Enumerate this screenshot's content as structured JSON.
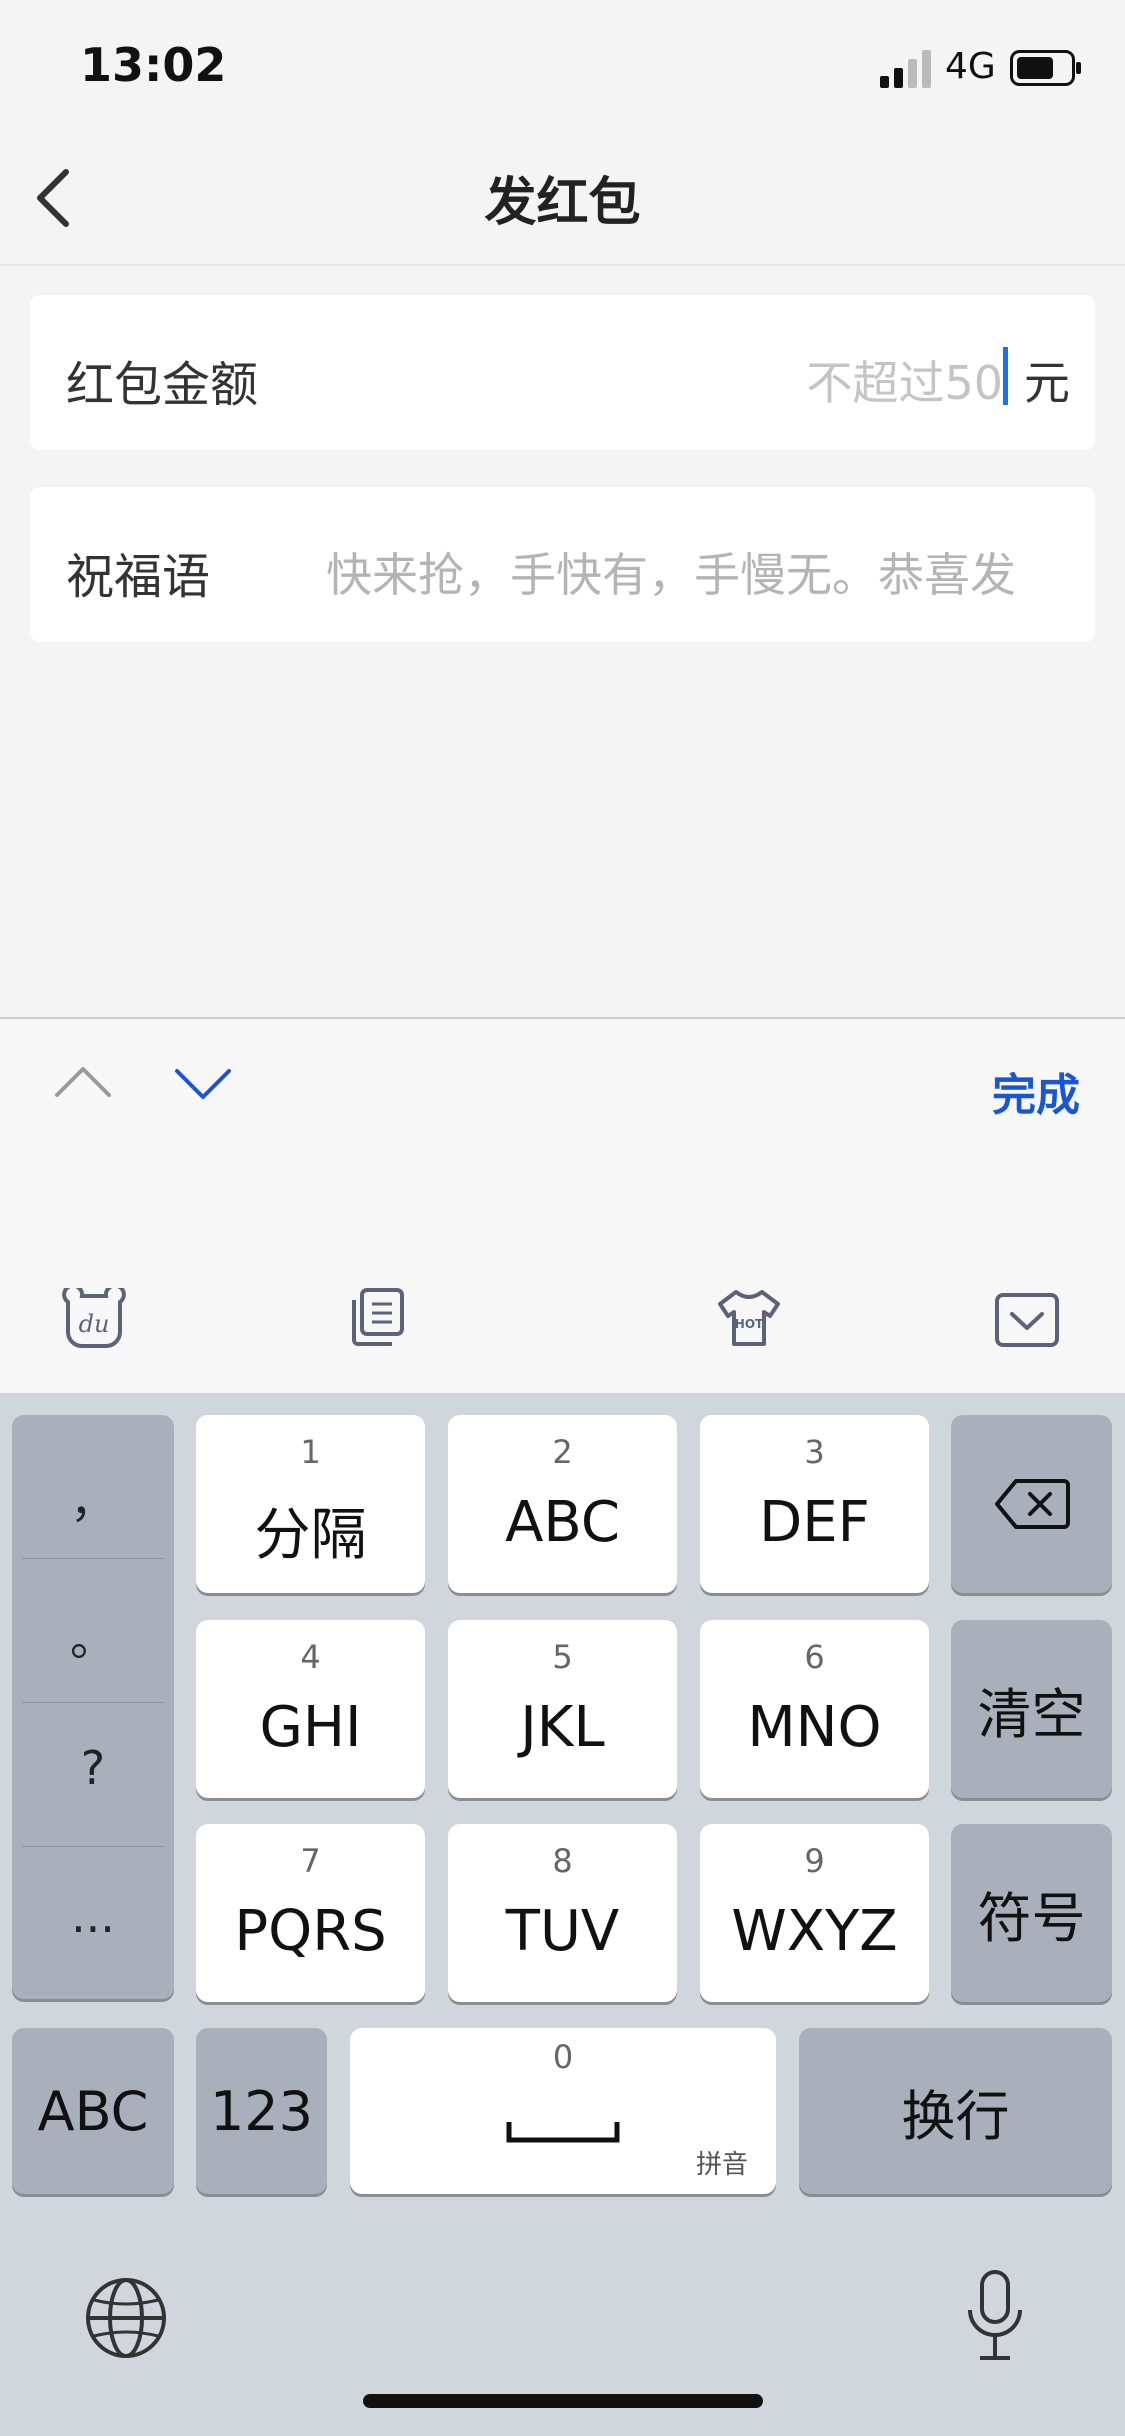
{
  "status_bar": {
    "time": "13:02",
    "network": "4G"
  },
  "nav": {
    "title": "发红包"
  },
  "amount": {
    "label": "红包金额",
    "placeholder": "不超过50",
    "unit": "元"
  },
  "greeting": {
    "label": "祝福语",
    "placeholder": "快来抢，手快有，手慢无。恭喜发"
  },
  "accessory": {
    "done_label": "完成"
  },
  "ime_toolbar": {
    "icons": [
      "du-logo-icon",
      "clipboard-icon",
      "hot-shirt-icon",
      "collapse-keyboard-icon"
    ],
    "hot_text": "HOT"
  },
  "keyboard": {
    "symbols": [
      "，",
      "。",
      "?",
      "..."
    ],
    "keys": [
      {
        "num": "1",
        "label": "分隔"
      },
      {
        "num": "2",
        "label": "ABC"
      },
      {
        "num": "3",
        "label": "DEF"
      },
      {
        "num": "4",
        "label": "GHI"
      },
      {
        "num": "5",
        "label": "JKL"
      },
      {
        "num": "6",
        "label": "MNO"
      },
      {
        "num": "7",
        "label": "PQRS"
      },
      {
        "num": "8",
        "label": "TUV"
      },
      {
        "num": "9",
        "label": "WXYZ"
      }
    ],
    "clear_label": "清空",
    "symbol_label": "符号",
    "abc_label": "ABC",
    "num_label": "123",
    "space": {
      "num": "0",
      "sub": "拼音"
    },
    "enter_label": "换行"
  },
  "colors": {
    "accent": "#1a55d6",
    "keyboard_bg": "#d1d5dc",
    "dark_key": "#a9b0bb",
    "caret": "#1a73e8"
  }
}
